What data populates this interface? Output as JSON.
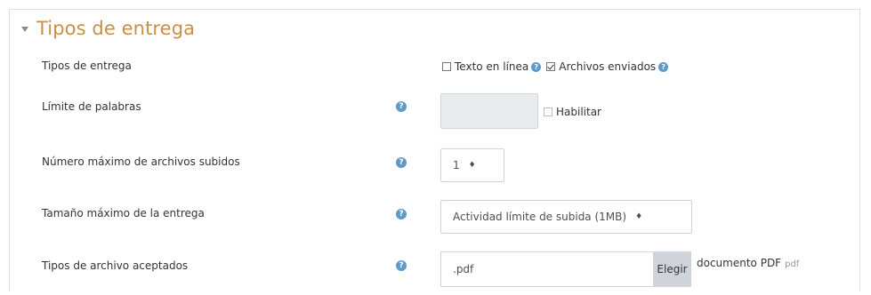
{
  "section": {
    "title": "Tipos de entrega"
  },
  "fields": {
    "submission_types": {
      "label": "Tipos de entrega",
      "options": [
        {
          "label": "Texto en línea",
          "checked": false
        },
        {
          "label": "Archivos enviados",
          "checked": true
        }
      ]
    },
    "word_limit": {
      "label": "Límite de palabras",
      "value": "",
      "enable_label": "Habilitar",
      "enabled": false
    },
    "max_files": {
      "label": "Número máximo de archivos subidos",
      "selected": "1"
    },
    "max_size": {
      "label": "Tamaño máximo de la entrega",
      "selected": "Actividad límite de subida (1MB)"
    },
    "accepted_types": {
      "label": "Tipos de archivo aceptados",
      "value": ".pdf",
      "choose_label": "Elegir",
      "description": "documento PDF",
      "extension": "pdf"
    }
  },
  "colors": {
    "section_title": "#c7904a",
    "help_icon": "#5e9bc8",
    "disabled_input": "#e9ecef"
  }
}
